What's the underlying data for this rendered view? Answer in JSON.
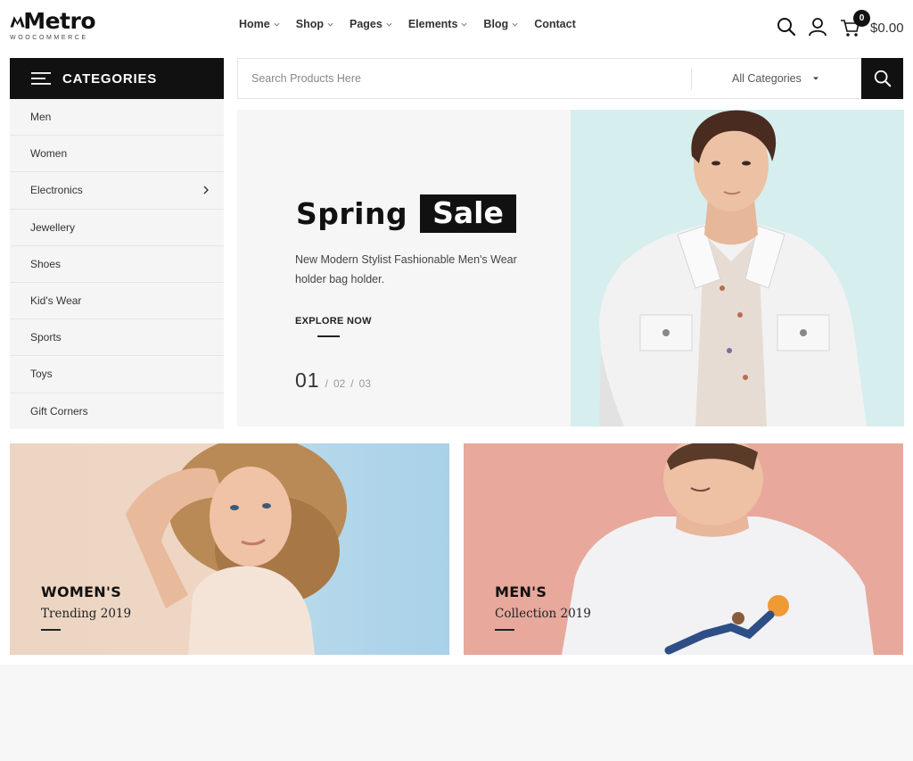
{
  "header": {
    "logo_text": "Metro",
    "logo_sub": "WOOCOMMERCE",
    "nav": [
      {
        "label": "Home"
      },
      {
        "label": "Shop"
      },
      {
        "label": "Pages"
      },
      {
        "label": "Elements"
      },
      {
        "label": "Blog"
      },
      {
        "label": "Contact"
      }
    ],
    "cart_count": "0",
    "cart_total": "$0.00"
  },
  "categories": {
    "title": "CATEGORIES",
    "items": [
      {
        "label": "Men"
      },
      {
        "label": "Women"
      },
      {
        "label": "Electronics"
      },
      {
        "label": "Jewellery"
      },
      {
        "label": "Shoes"
      },
      {
        "label": "Kid's Wear"
      },
      {
        "label": "Sports"
      },
      {
        "label": "Toys"
      },
      {
        "label": "Gift Corners"
      }
    ]
  },
  "search": {
    "placeholder": "Search Products Here",
    "category": "All Categories"
  },
  "hero": {
    "word1": "Spring",
    "word2": "Sale",
    "description": "New Modern Stylist Fashionable Men's Wear holder bag holder.",
    "cta": "EXPLORE NOW",
    "slide_current": "01",
    "slide_sep": "/",
    "slide_2": "02",
    "slide_3": "03"
  },
  "banners": {
    "women": {
      "title": "WOMEN'S",
      "subtitle": "Trending 2019"
    },
    "men": {
      "title": "MEN'S",
      "subtitle": "Collection 2019"
    }
  },
  "colors": {
    "accent": "#111111",
    "hero_bg": "#f6f6f6",
    "hero_image_bg": "#d6eeee",
    "women_banner_bg": "#ecd5c3",
    "men_banner_bg": "#e8a89c"
  },
  "icons": [
    "search-icon",
    "user-icon",
    "cart-icon",
    "menu-icon",
    "chevron-right-icon",
    "chevron-down-icon"
  ]
}
